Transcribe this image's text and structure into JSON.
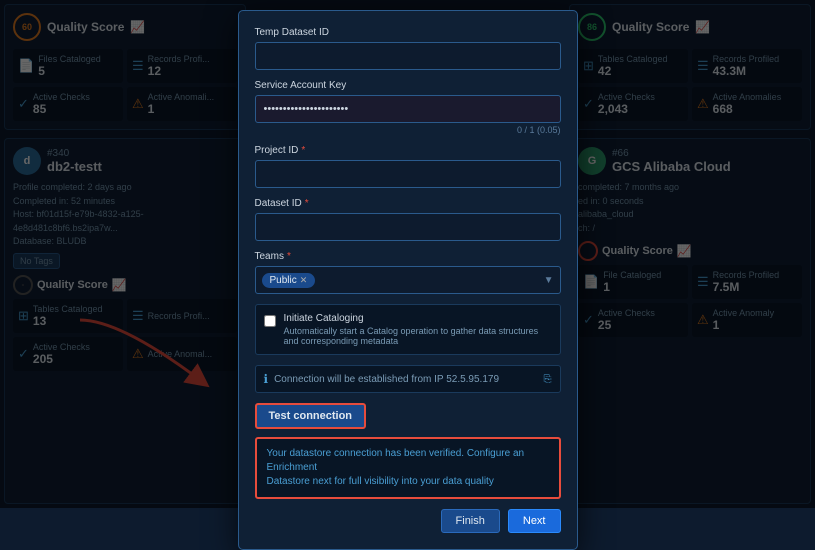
{
  "left_top_card": {
    "score": "60",
    "title": "Quality Score",
    "files_cataloged_label": "Files Cataloged",
    "files_cataloged_value": "5",
    "records_profiled_label": "Records Profi...",
    "records_profiled_value": "12",
    "active_checks_label": "Active Checks",
    "active_checks_value": "85",
    "active_anomalies_label": "Active Anomali...",
    "active_anomalies_value": "1"
  },
  "left_bottom_profile": {
    "id": "#340",
    "name": "db2-testt",
    "profile_completed": "Profile completed: 2 days ago",
    "completed_in": "Completed in: 52 minutes",
    "host": "Host: bf01d15f-e79b-4832-a125-4e8d481c8bf6.bs2ipa7w...",
    "database": "Database: BLUDB",
    "no_tags": "No Tags",
    "quality_score_label": "Quality Score",
    "tables_cataloged_label": "Tables Cataloged",
    "tables_cataloged_value": "13",
    "records_profiled_label": "Records Profi...",
    "active_checks_label": "Active Checks",
    "active_checks_value": "205",
    "active_anomalies_label": "Active Anomal..."
  },
  "right_top_card": {
    "score": "86",
    "title": "Quality Score",
    "tables_cataloged_label": "Tables Cataloged",
    "tables_cataloged_value": "42",
    "records_profiled_label": "Records Profiled",
    "records_profiled_value": "43.3M",
    "active_checks_label": "Active Checks",
    "active_checks_value": "2,043",
    "active_anomalies_label": "Active Anomalies",
    "active_anomalies_value": "668"
  },
  "right_bottom_profile": {
    "id": "#66",
    "name": "GCS Alibaba Cloud",
    "completed": "completed: 7 months ago",
    "completed_in": "ed in: 0 seconds",
    "host": "alibaba_cloud",
    "text3": "ch: /",
    "quality_score_label": "Quality Score",
    "files_cataloged_label": "File Cataloged",
    "files_cataloged_value": "1",
    "records_profiled_label": "Records Profiled",
    "records_profiled_value": "7.5M",
    "active_checks_label": "Active Checks",
    "active_checks_value": "25",
    "active_anomalies_label": "Active Anomaly",
    "active_anomalies_value": "1"
  },
  "modal": {
    "temp_dataset_id_label": "Temp Dataset ID",
    "service_account_key_label": "Service Account Key",
    "service_account_key_hint": "0 / 1 (0.05)",
    "project_id_label": "Project ID",
    "required": "*",
    "dataset_id_label": "Dataset ID",
    "teams_label": "Teams",
    "teams_value": "Public",
    "initiate_cataloging_label": "Initiate Cataloging",
    "initiate_cataloging_sublabel": "Automatically start a Catalog operation to gather data structures and corresponding metadata",
    "connection_info": "Connection will be established from IP 52.5.95.179",
    "test_connection_btn": "Test connection",
    "success_message_line1": "Your datastore connection has been verified. Configure an Enrichment",
    "success_message_line2": "Datastore next for full visibility into your data quality",
    "finish_btn": "Finish",
    "next_btn": "Next"
  },
  "colors": {
    "accent_blue": "#4a9fd4",
    "accent_orange": "#e67e22",
    "accent_red": "#e74c3c",
    "accent_green": "#2ecc71",
    "bg_dark": "#0d1b2e",
    "bg_card": "#0f2035"
  }
}
